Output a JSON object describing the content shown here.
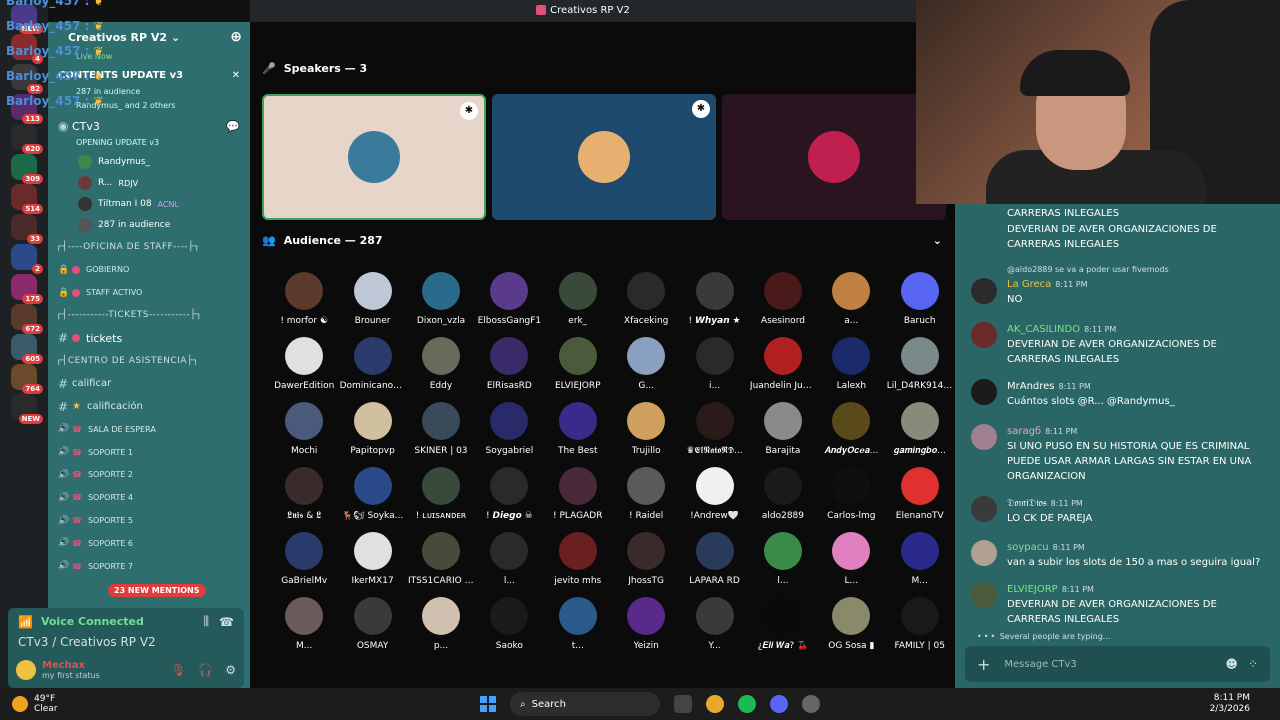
{
  "window": {
    "title": "Creativos RP V2"
  },
  "overlay": {
    "names": [
      "Barloy_457 :",
      "Barloy_457 :",
      "Barloy_457 :",
      "Barloy_457 :",
      "Barloy_457 :"
    ]
  },
  "server": {
    "name": "Creativos RP V2",
    "live_badge": "Live Now"
  },
  "guild_badges": [
    "NEW",
    "4",
    "82",
    "113",
    "620",
    "309",
    "514",
    "33",
    "2",
    "175",
    "672",
    "605",
    "764",
    "NEW"
  ],
  "channels": {
    "event_title": "CONTENTS UPDATE v3",
    "event_sub": "287 in audience",
    "event_people": "Randymus_ and 2 others",
    "stage_channel": "CTv3",
    "stage_topic": "OPENING UPDATE v3",
    "voice_users": [
      "Randymus_",
      "R...",
      "Tiltman I 08"
    ],
    "voice_tags": [
      "",
      "RDJV",
      "ACNL"
    ],
    "audience_count": "287 in audience",
    "cat_staff": "┌┤----OFICINA DE STAFF----├┐",
    "staff_channels": [
      "GOBIERNO",
      "STAFF ACTIVO"
    ],
    "cat_tickets": "┌┤-----------TICKETS-----------├┐",
    "tickets": "tickets",
    "cat_assist": "┌┤CENTRO DE ASISTENCIA├┐",
    "assist_channels": [
      "calificar",
      "calificación"
    ],
    "voice_channels": [
      "SALA DE ESPERA",
      "SOPORTE 1",
      "SOPORTE 2",
      "SOPORTE 4",
      "SOPORTE 5",
      "SOPORTE 6",
      "SOPORTE 7"
    ],
    "mentions": "23 NEW MENTIONS"
  },
  "voice_panel": {
    "status": "Voice Connected",
    "location": "CTv3 / Creativos RP V2",
    "username": "Mechax",
    "user_status": "my first status"
  },
  "stage": {
    "speakers_title": "Speakers — 3",
    "audience_title": "Audience — 287",
    "speaker_colors": [
      "#e6d5c8",
      "#1e4a6e",
      "#2a1420"
    ],
    "audience": [
      {
        "name": "! morfor ☯",
        "color": "#5a3a2a"
      },
      {
        "name": "Brouner",
        "color": "#c0c8d8"
      },
      {
        "name": "Dixon_vzla",
        "color": "#2a6a8a"
      },
      {
        "name": "ElbossGangF1",
        "color": "#5a3a8a"
      },
      {
        "name": "erk_",
        "color": "#3a4a3a"
      },
      {
        "name": "Xfaceking",
        "color": "#2a2a2a"
      },
      {
        "name": "! 𝙒𝙝𝙮𝙖𝙣 ★",
        "color": "#3a3a3a"
      },
      {
        "name": "Asesinord",
        "color": "#4a1a1a"
      },
      {
        "name": "a...",
        "color": "#c08040"
      },
      {
        "name": "Baruch",
        "color": "#5865f2"
      },
      {
        "name": "DawerEdition",
        "color": "#e0e0e0"
      },
      {
        "name": "DominicanoG...",
        "color": "#2a3a6a"
      },
      {
        "name": "Eddy",
        "color": "#6a6a5a"
      },
      {
        "name": "ElRisasRD",
        "color": "#3a2a6a"
      },
      {
        "name": "ELVIEJORP",
        "color": "#4a5a3a"
      },
      {
        "name": "G...",
        "color": "#8aa0c0"
      },
      {
        "name": "i...",
        "color": "#2a2a2a"
      },
      {
        "name": "Juandelin Jue...",
        "color": "#b02020"
      },
      {
        "name": "Lalexh",
        "color": "#1a2a6a"
      },
      {
        "name": "Lil_D4RK914 ...",
        "color": "#7a8a8a"
      },
      {
        "name": "Mochi",
        "color": "#4a5a7a"
      },
      {
        "name": "Papitopvp",
        "color": "#d0c0a0"
      },
      {
        "name": "SKINER | 03",
        "color": "#3a4a5a"
      },
      {
        "name": "Soygabriel",
        "color": "#2a2a6a"
      },
      {
        "name": "The Best",
        "color": "#3a2a8a"
      },
      {
        "name": "Trujillo",
        "color": "#d0a060"
      },
      {
        "name": "♛𝕰𝖑𝕹𝖆𝖙𝖔𝕽𝕯...",
        "color": "#2a1a1a"
      },
      {
        "name": "Barajita",
        "color": "#8a8a8a"
      },
      {
        "name": "𝑨𝒏𝒅𝒚𝑶𝒄𝒆𝒂...",
        "color": "#5a4a1a"
      },
      {
        "name": "𝒈𝒂𝒎𝒊𝒏𝒈𝒃𝒐...",
        "color": "#8a8a7a"
      },
      {
        "name": "𝕷𝖚𝖎𝖘 & 𝕷",
        "color": "#3a2a2a"
      },
      {
        "name": "🦌🐿 Soyka...",
        "color": "#2a4a8a"
      },
      {
        "name": "! ʟᴜɪsᴀɴᴅᴇʀ",
        "color": "#3a4a3a"
      },
      {
        "name": "! 𝘿𝙞𝙚𝙜𝙤 ☠",
        "color": "#2a2a2a"
      },
      {
        "name": "! PLAGADR",
        "color": "#4a2a3a"
      },
      {
        "name": "! Raidel",
        "color": "#5a5a5a"
      },
      {
        "name": "!Andrew🤍",
        "color": "#f0f0f0"
      },
      {
        "name": "aldo2889",
        "color": "#1a1a1a"
      },
      {
        "name": "Carlos-lmg",
        "color": "#0f0f0f"
      },
      {
        "name": "ElenanoTV",
        "color": "#e03030"
      },
      {
        "name": "GaBrielMv",
        "color": "#2a3a6a"
      },
      {
        "name": "IkerMX17",
        "color": "#e0e0e0"
      },
      {
        "name": "ITSS1CARIO O...",
        "color": "#4a4a3a"
      },
      {
        "name": "l...",
        "color": "#2a2a2a"
      },
      {
        "name": "jevito mhs",
        "color": "#6a2020"
      },
      {
        "name": "JhossTG",
        "color": "#3a2a2a"
      },
      {
        "name": "LAPARA RD",
        "color": "#2a3a5a"
      },
      {
        "name": "l...",
        "color": "#3a8a4a"
      },
      {
        "name": "L...",
        "color": "#e080c0"
      },
      {
        "name": "M...",
        "color": "#2a2a8a"
      },
      {
        "name": "M...",
        "color": "#6a5a5a"
      },
      {
        "name": "OSMAY",
        "color": "#3a3a3a"
      },
      {
        "name": "p...",
        "color": "#d0c0b0"
      },
      {
        "name": "Saoko",
        "color": "#1a1a1a"
      },
      {
        "name": "t...",
        "color": "#2a5a8a"
      },
      {
        "name": "Yeizin",
        "color": "#5a2a8a"
      },
      {
        "name": "Y...",
        "color": "#3a3a3a"
      },
      {
        "name": "¿𝑬𝒍𝒊 𝑾𝒂? 🍒",
        "color": "#0a0a0a"
      },
      {
        "name": "OG Sosa ▮",
        "color": "#8a8a6a"
      },
      {
        "name": "FAMILY | 05",
        "color": "#1a1a1a"
      }
    ]
  },
  "chat": {
    "messages": [
      {
        "author": "",
        "time": "",
        "text": "CARRERAS INLEGALES",
        "color": "#ffffff",
        "avatar": "#2b6666"
      },
      {
        "author": "",
        "time": "",
        "text": "DEVERIAN DE AVER  ORGANIZACIONES  DE CARRERAS INLEGALES",
        "color": "#ffffff",
        "avatar": "#2b6666"
      },
      {
        "author": "La Greca",
        "time": "8:11 PM",
        "text": "NO",
        "color": "#f0c040",
        "avatar": "#2a2a2a",
        "reply": "@aldo2889 se va a poder usar fivemods"
      },
      {
        "author": "AK_CASILINDO",
        "time": "8:11 PM",
        "text": "DEVERIAN DE AVER  ORGANIZACIONES  DE CARRERAS INLEGALES",
        "color": "#7de08a",
        "avatar": "#6a2a2a"
      },
      {
        "author": "MrAndres",
        "time": "8:11 PM",
        "text": "Cuántos slots @R... @Randymus_",
        "color": "#ffffff",
        "avatar": "#1a1a1a"
      },
      {
        "author": "saragб",
        "time": "8:11 PM",
        "text": "SI UNO PUSO EN SU HISTORIA QUE ES CRIMINAL PUEDE USAR ARMAR LARGAS SIN ESTAR EN UNA ORGANIZACION",
        "color": "#f0a0c0",
        "avatar": "#a08090"
      },
      {
        "author": "𝔇𝔬𝔪𝔦𝔇𝔦𝔬𝔰",
        "time": "8:11 PM",
        "text": "LO CK DE PAREJA",
        "color": "#ffffff",
        "avatar": "#3a3a3a"
      },
      {
        "author": "soypacu",
        "time": "8:11 PM",
        "text": "van a subir los slots de 150 a mas o seguira igual?",
        "color": "#7de08a",
        "avatar": "#b0a090"
      },
      {
        "author": "ELVIEJORP",
        "time": "8:11 PM",
        "text": "DEVERIAN DE AVER  ORGANIZACIONES  DE CARRERAS INLEGALES",
        "color": "#7de08a",
        "avatar": "#4a5a3a"
      }
    ],
    "typing": "Several people are typing...",
    "placeholder": "Message CTv3"
  },
  "taskbar": {
    "temp": "49°F",
    "weather": "Clear",
    "search": "Search",
    "time": "8:11 PM",
    "date": "2/3/2026"
  }
}
